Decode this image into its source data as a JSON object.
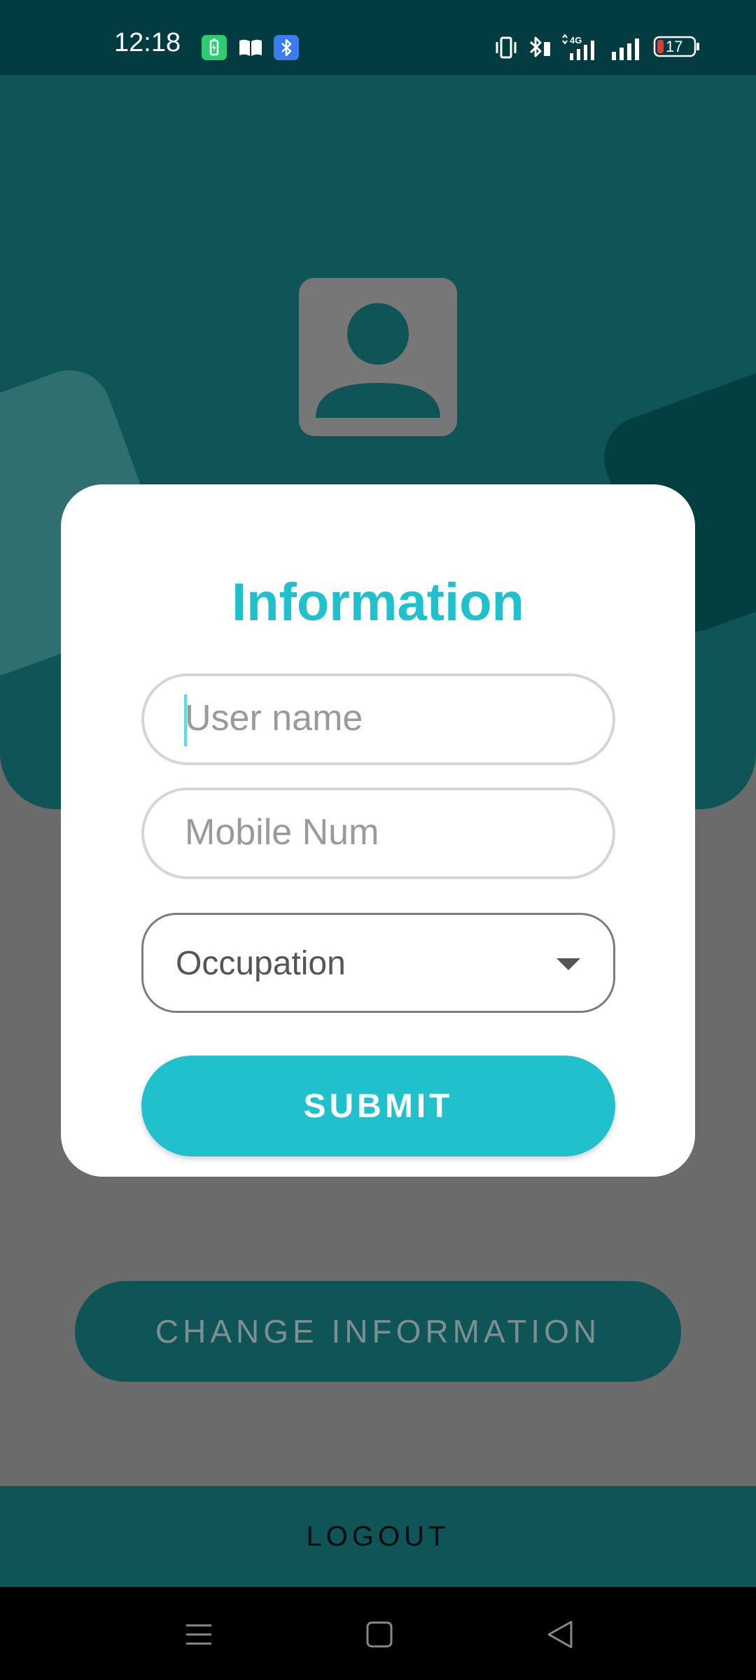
{
  "status_bar": {
    "time": "12:18",
    "battery_level": "17",
    "notification_icons": [
      "battery-saver-icon",
      "book-icon",
      "bluetooth-icon"
    ],
    "system_icons": [
      "vibrate-icon",
      "bluetooth-icon",
      "network-4g-icon",
      "signal-icon",
      "signal-icon",
      "battery-icon"
    ]
  },
  "dialog": {
    "title": "Information",
    "username_placeholder": "User name",
    "mobile_placeholder": "Mobile Num",
    "occupation_selected": "Occupation",
    "submit_label": "SUBMIT"
  },
  "page": {
    "change_info_label": "CHANGE INFORMATION",
    "logout_label": "LOGOUT"
  },
  "colors": {
    "accent": "#20c0cc",
    "header": "#0f5456",
    "status_bar": "#023c40",
    "scrim": "#6b6b6b"
  }
}
